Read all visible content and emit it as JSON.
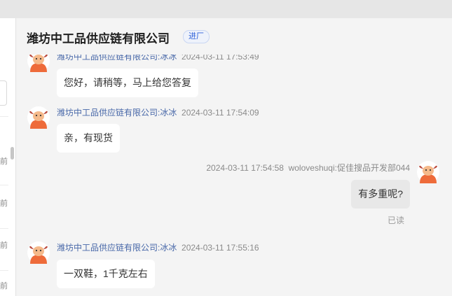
{
  "header": {
    "title": "潍坊中工品供应链有限公司",
    "badge": "进厂"
  },
  "sidebar": {
    "ago_label": "前"
  },
  "messages": [
    {
      "sender": "潍坊中工品供应链有限公司:冰冰",
      "time": "2024-03-11 17:53:49",
      "text": "您好，请稍等，马上给您答复"
    },
    {
      "sender": "潍坊中工品供应链有限公司:冰冰",
      "time": "2024-03-11 17:54:09",
      "text": "亲，有现货"
    },
    {
      "sender": "woloveshuqi:促佳搜品开发部044",
      "time": "2024-03-11 17:54:58",
      "text": "有多重呢?",
      "status": "已读"
    },
    {
      "sender": "潍坊中工品供应链有限公司:冰冰",
      "time": "2024-03-11 17:55:16",
      "text": "一双鞋，1千克左右"
    }
  ],
  "colors": {
    "avatar_bg": "#ee6b3a",
    "avatar_face": "#f5b98a",
    "link_name": "#4767a8"
  }
}
